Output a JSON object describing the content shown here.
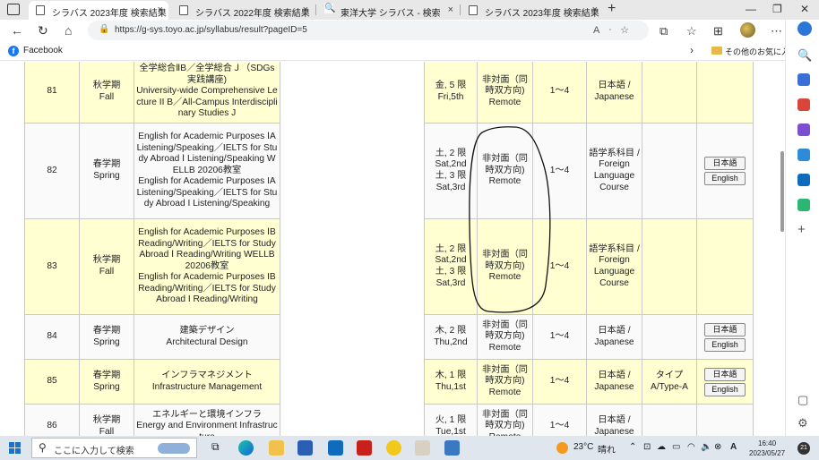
{
  "tabs": [
    {
      "label": "シラバス 2023年度 検索結果",
      "close": "×"
    },
    {
      "label": "シラバス 2022年度 検索結果",
      "close": "×"
    },
    {
      "label": "東洋大学 シラバス - 検索",
      "close": "×"
    },
    {
      "label": "シラバス 2023年度 検索結果",
      "close": "×"
    }
  ],
  "address_bar": {
    "url": "https://g-sys.toyo.ac.jp/syllabus/result?pageID=5"
  },
  "favorites": {
    "facebook": "Facebook",
    "other": "その他のお気に入り"
  },
  "rows": [
    {
      "no": "81",
      "term_ja": "秋学期",
      "term_en": "Fall",
      "course_lines": [
        "全学総合ⅡB／全学総合Ｊ（SDGs実践講座)",
        "University-wide Comprehensive Lecture II B／All-Campus Interdisciplinary Studies J"
      ],
      "period_lines": [
        "金, 5 限",
        "Fri,5th"
      ],
      "mode_lines": [
        "非対面（同",
        "時双方向)",
        "Remote"
      ],
      "year": "1〜4",
      "lang": "日本語 / Japanese",
      "type": "",
      "buttons": []
    },
    {
      "no": "82",
      "term_ja": "春学期",
      "term_en": "Spring",
      "course_lines": [
        "English for Academic Purposes ⅠA Listening/Speaking／IELTS for Study Abroad Ⅰ Listening/Speaking WELLB 20206教室",
        "English for Academic Purposes IA Listening/Speaking／IELTS for Study Abroad I Listening/Speaking"
      ],
      "period_lines": [
        "土, 2 限",
        "Sat,2nd",
        "土, 3 限",
        "Sat,3rd"
      ],
      "mode_lines": [
        "非対面（同",
        "時双方向)",
        "Remote"
      ],
      "year": "1〜4",
      "lang": "語学系科目 / Foreign Language Course",
      "type": "",
      "buttons": [
        "日本語",
        "English"
      ]
    },
    {
      "no": "83",
      "term_ja": "秋学期",
      "term_en": "Fall",
      "course_lines": [
        "English for Academic Purposes ⅠB Reading/Writing／IELTS for Study Abroad Ⅰ Reading/Writing WELLB 20206教室",
        "English for Academic Purposes IB Reading/Writing／IELTS for Study Abroad I Reading/Writing"
      ],
      "period_lines": [
        "土, 2 限",
        "Sat,2nd",
        "土, 3 限",
        "Sat,3rd"
      ],
      "mode_lines": [
        "非対面（同",
        "時双方向)",
        "Remote"
      ],
      "year": "1〜4",
      "lang": "語学系科目 / Foreign Language Course",
      "type": "",
      "buttons": []
    },
    {
      "no": "84",
      "term_ja": "春学期",
      "term_en": "Spring",
      "course_lines": [
        "建築デザイン",
        "Architectural Design"
      ],
      "period_lines": [
        "木, 2 限",
        "Thu,2nd"
      ],
      "mode_lines": [
        "非対面（同",
        "時双方向)",
        "Remote"
      ],
      "year": "1〜4",
      "lang": "日本語 / Japanese",
      "type": "",
      "buttons": [
        "日本語",
        "English"
      ]
    },
    {
      "no": "85",
      "term_ja": "春学期",
      "term_en": "Spring",
      "course_lines": [
        "インフラマネジメント",
        "Infrastructure Management"
      ],
      "period_lines": [
        "木, 1 限",
        "Thu,1st"
      ],
      "mode_lines": [
        "非対面（同",
        "時双方向)",
        "Remote"
      ],
      "year": "1〜4",
      "lang": "日本語 / Japanese",
      "type": "タイプA/Type-A",
      "buttons": [
        "日本語",
        "English"
      ]
    },
    {
      "no": "86",
      "term_ja": "秋学期",
      "term_en": "Fall",
      "course_lines": [
        "エネルギーと環境インフラ",
        "Energy and Environment Infrastructure"
      ],
      "period_lines": [
        "火, 1 限",
        "Tue,1st"
      ],
      "mode_lines": [
        "非対面（同",
        "時双方向)",
        "Remote"
      ],
      "year": "1〜4",
      "lang": "日本語 / Japanese",
      "type": "",
      "buttons": []
    }
  ],
  "taskbar": {
    "search_placeholder": "ここに入力して検索",
    "temperature": "23°C",
    "weather": "晴れ",
    "ime": "A",
    "time": "16:40",
    "date": "2023/05/27",
    "notifications": "21"
  }
}
